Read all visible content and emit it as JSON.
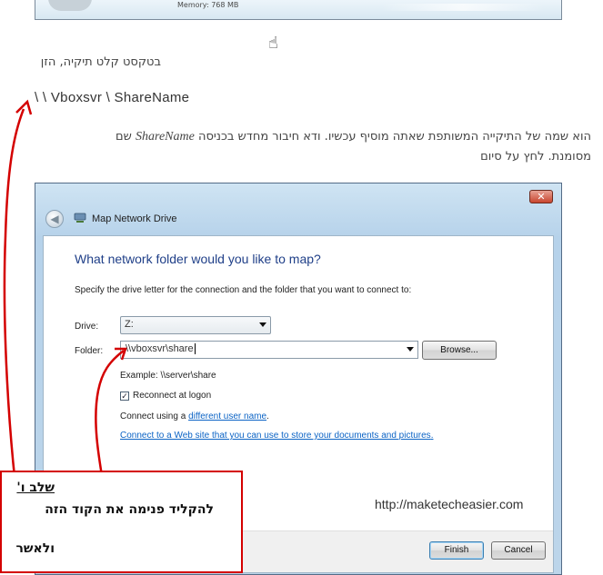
{
  "top_panel": {
    "memory_text": "Memory: 768 MB"
  },
  "instructions": {
    "line1": "בטקסט קלט תיקיה, הזן",
    "unc_path": "\\ \\ Vboxsvr \\ ShareName",
    "line2_part1": "הוא שמה של התיקייה המשותפת שאתה מוסיף עכשיו. ודא חיבור מחדש בכניסה",
    "line2_share": "ShareName",
    "line2_part2": "שם",
    "line3": "מסומנת. לחץ על סיום"
  },
  "dialog": {
    "title": "Map Network Drive",
    "close_label": "✕",
    "back_label": "◀",
    "question": "What network folder would you like to map?",
    "specify": "Specify the drive letter for the connection and the folder that you want to connect to:",
    "drive_label": "Drive:",
    "drive_value": "Z:",
    "folder_label": "Folder:",
    "folder_value": "\\\\vboxsvr\\share",
    "browse_label": "Browse...",
    "example": "Example: \\\\server\\share",
    "reconnect_label": "Reconnect at logon",
    "reconnect_checked": true,
    "connect_using_prefix": "Connect using a ",
    "connect_using_link": "different user name",
    "connect_using_suffix": ".",
    "web_link": "Connect to a Web site that you can use to store your documents and pictures",
    "web_link_suffix": ".",
    "watermark": "http://maketecheasier.com",
    "finish_label": "Finish",
    "cancel_label": "Cancel"
  },
  "annotation": {
    "heading": "שלב ו'",
    "line1": "להקליד פנימה את הקוד הזה",
    "line2": "ולאשר",
    "border_color": "#d40000"
  }
}
